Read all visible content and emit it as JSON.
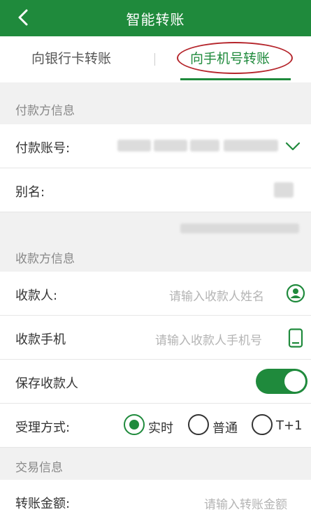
{
  "header": {
    "title": "智能转账"
  },
  "tabs": [
    {
      "label": "向银行卡转账",
      "active": false
    },
    {
      "label": "向手机号转账",
      "active": true
    }
  ],
  "payer_section": {
    "title": "付款方信息"
  },
  "payer_account": {
    "label": "付款账号:"
  },
  "alias": {
    "label": "别名:"
  },
  "payee_section": {
    "title": "收款方信息"
  },
  "payee": {
    "label": "收款人:",
    "placeholder": "请输入收款人姓名"
  },
  "payee_phone": {
    "label": "收款手机",
    "placeholder": "请输入收款人手机号"
  },
  "save_payee": {
    "label": "保存收款人",
    "enabled": true
  },
  "processing": {
    "label": "受理方式:",
    "options": [
      {
        "label": "实时",
        "selected": true
      },
      {
        "label": "普通",
        "selected": false
      },
      {
        "label": "T+1",
        "selected": false
      }
    ]
  },
  "transaction_section": {
    "title": "交易信息"
  },
  "amount": {
    "label": "转账金额:",
    "placeholder": "请输入转账金额"
  },
  "colors": {
    "brand": "#1f8a3c",
    "annotation": "#b5252b"
  }
}
